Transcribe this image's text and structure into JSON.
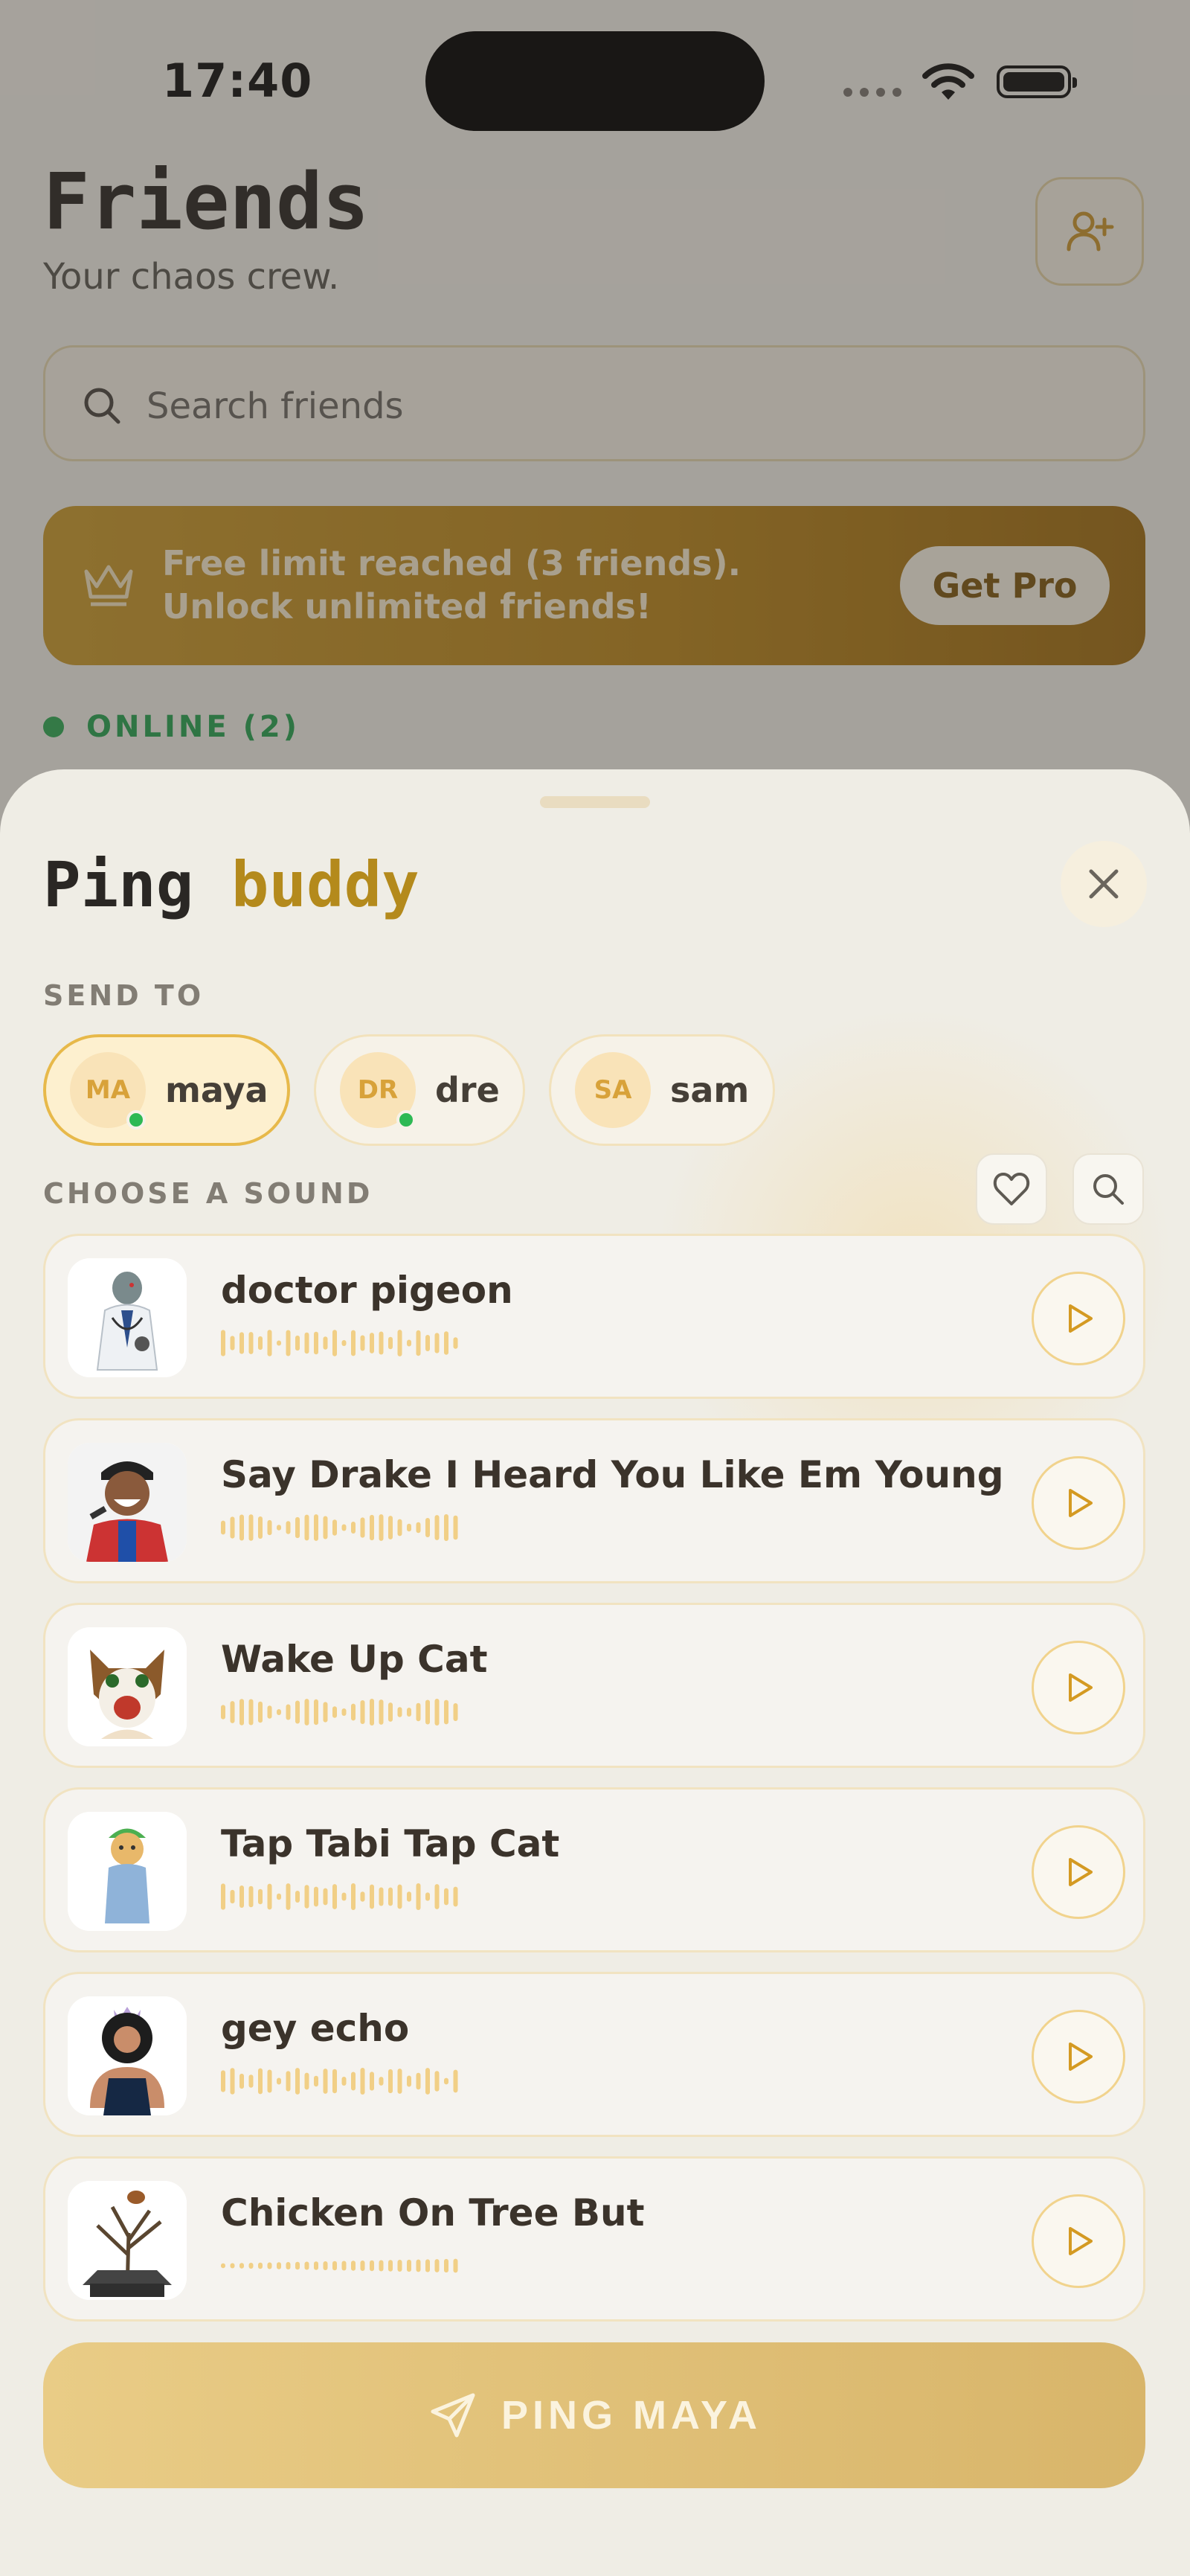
{
  "status_bar": {
    "time": "17:40"
  },
  "page": {
    "title": "Friends",
    "subtitle": "Your chaos crew.",
    "add_friend_icon": "user-plus-icon",
    "search": {
      "placeholder": "Search friends"
    },
    "banner": {
      "icon": "crown-icon",
      "text": "Free limit reached (3 friends). Unlock unlimited friends!",
      "button_label": "Get Pro"
    },
    "online_label": "ONLINE (2)"
  },
  "sheet": {
    "title_part1": "Ping",
    "title_part2": "buddy",
    "close_icon": "close-icon",
    "send_to_label": "SEND TO",
    "recipients": [
      {
        "initials": "MA",
        "name": "maya",
        "online": true,
        "selected": true
      },
      {
        "initials": "DR",
        "name": "dre",
        "online": true,
        "selected": false
      },
      {
        "initials": "SA",
        "name": "sam",
        "online": false,
        "selected": false
      }
    ],
    "choose_sound_label": "CHOOSE A SOUND",
    "favorites_icon": "heart-icon",
    "search_icon": "search-icon",
    "sounds": [
      {
        "name": "doctor pigeon",
        "thumb": "pigeon-doctor-image"
      },
      {
        "name": "Say Drake I Heard You Like Em Young",
        "thumb": "drake-singing-image"
      },
      {
        "name": "Wake Up Cat",
        "thumb": "screaming-cat-image"
      },
      {
        "name": "Tap Tabi Tap Cat",
        "thumb": "cat-green-hat-image"
      },
      {
        "name": "gey echo",
        "thumb": "queen-figure-image"
      },
      {
        "name": "Chicken On Tree But",
        "thumb": "chicken-tree-image"
      }
    ],
    "ping_button_label": "PING MAYA",
    "ping_button_icon": "send-icon"
  },
  "colors": {
    "accent": "#b48a1c",
    "banner": "#b9861d",
    "online": "#2faa55",
    "ping_button": "#e2c27a"
  }
}
